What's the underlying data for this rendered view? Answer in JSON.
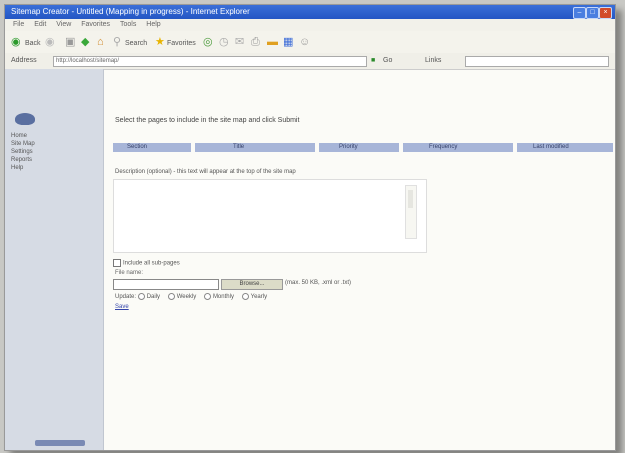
{
  "window": {
    "title": "Sitemap Creator - Untitled (Mapping in progress) - Internet Explorer",
    "controls": [
      "min-button",
      "max-button",
      "close-button"
    ]
  },
  "menu": {
    "items": [
      "File",
      "Edit",
      "View",
      "Favorites",
      "Tools",
      "Help"
    ]
  },
  "toolbar": {
    "back_label": "Back",
    "search_label": "Search",
    "favorites_label": "Favorites",
    "icons": [
      "back-icon",
      "forward-icon",
      "stop-icon",
      "refresh-icon",
      "home-icon",
      "search-icon",
      "favorites-icon",
      "media-icon",
      "history-icon",
      "mail-icon",
      "print-icon",
      "edit-icon",
      "discuss-icon",
      "messenger-icon"
    ]
  },
  "address": {
    "label": "Address",
    "value": "http://localhost/sitemap/",
    "go_label": "Go",
    "links_label": "Links"
  },
  "sidebar": {
    "items": [
      "Home",
      "Site Map",
      "Settings",
      "Reports",
      "Help"
    ]
  },
  "main": {
    "heading": "Select the pages to include in the site map and click Submit",
    "columns": [
      "Section",
      "Title",
      "Priority",
      "Frequency",
      "Last modified"
    ],
    "memo_label": "Description (optional) - this text will appear at the top of the site map",
    "checkbox_label": "Include all sub-pages",
    "file_label": "File name:",
    "browse_label": "Browse...",
    "hint": "(max. 50 KB, .xml or .txt)",
    "options": [
      "Daily",
      "Weekly",
      "Monthly",
      "Yearly"
    ],
    "options_label": "Update:",
    "link_label": "Save"
  }
}
